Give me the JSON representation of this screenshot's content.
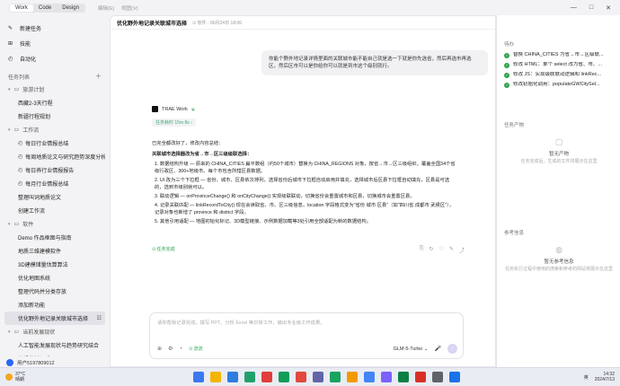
{
  "titlebar": {
    "modes": [
      "Work",
      "Code",
      "Design"
    ],
    "extras": [
      "编辑(E)",
      "视图(V)"
    ],
    "controls": [
      "—",
      "□",
      "✕"
    ]
  },
  "sidebar": {
    "top_items": [
      {
        "label": "新建任务",
        "icon": "edit-icon"
      },
      {
        "label": "技能",
        "icon": "grid-icon"
      },
      {
        "label": "自动化",
        "icon": "clock-icon"
      }
    ],
    "section_title": "任务列表",
    "groups": [
      {
        "name": "旅游计划",
        "items": [
          {
            "label": "西藏2-3天行程",
            "sched": false
          },
          {
            "label": "新疆行程规划",
            "sched": false
          }
        ]
      },
      {
        "name": "工作流",
        "items": [
          {
            "label": "每日行业情报总结",
            "sched": true
          },
          {
            "label": "每周地质论文与研究趋势深度分析",
            "sched": true
          },
          {
            "label": "每日养行业情报报告",
            "sched": true
          },
          {
            "label": "每月行业情报总结",
            "sched": true
          },
          {
            "label": "整理叫词地质论文",
            "sched": false
          },
          {
            "label": "创建工作流",
            "sched": false
          }
        ]
      },
      {
        "name": "软件",
        "items": [
          {
            "label": "Demo 作品框图与指南",
            "sched": false
          },
          {
            "label": "地质三维建模软件",
            "sched": false
          },
          {
            "label": "3D建模储量估算算法",
            "sched": false
          },
          {
            "label": "优化地图系统",
            "sched": false
          },
          {
            "label": "整理代码并分类存放",
            "sched": false
          },
          {
            "label": "添加新功能",
            "sched": false
          },
          {
            "label": "优化野外地记录关联城市选择",
            "sched": false,
            "active": true
          }
        ]
      },
      {
        "name": "当前发展现状",
        "items": [
          {
            "label": "人工智能发展现状与趋势研究结合",
            "sched": false
          },
          {
            "label": "地质学前沿成果",
            "sched": false
          }
        ]
      }
    ],
    "user": "用户5197809012"
  },
  "main": {
    "title": "优化野外地记录关联城市选择",
    "meta": "⊙ 软件 · 06月24日 18:06",
    "user_message": "你能个野外地记录详情里面的关联城市能不能自己就是选一下就是你先选省，然后再选市再选区，然后区市可以是你给你可以就是到市这个级别就行。",
    "bot_name": "TRAE Work",
    "bot_badge": "⬙",
    "task_time": "任务耗时 15m 8s ›",
    "answer_intro": "已完全都改好了，修改内容总结：",
    "answer_heading": "关联城市选择器改为省→市→区三级级联选择：",
    "answer_points": [
      "1. 数据结构升级 — 原来的 CHINA_CITIES 扁平数组（约50个城市）替换为 CHINA_REGIONS 对象，按省→市→区三级组织，覆盖全国34个省级行政区、300+地级市、每个市包含所辖区县数据。",
      "2. UI 改为三个下拉框 — 省份、城市、区县依次排列，选择省份后城市下拉框自动启用并填充，选择城市后区县下拉框自动填充，区县是可选的，选到市级别就可以。",
      "3. 联动逻辑 — onProvinceChange() 和 onCityChange() 实现级联联动，切换省份会重置城市和区县，切换城市会重置区县。",
      "4. 记录关联匹配 — linkRecordToCity() 现在会读取省、市、区三级信息，location 字段格式变为\"省份 城市 区县\"（如\"四川省 成都市 武侯区\"），记录对象也新增了 province 和 district 字段。",
      "5. 其他引用适配 — 地图初始化标记、3D模型链接、示例数据加载等3处引用全部适配为新的数据结构。"
    ],
    "done_tag": "⊙ 任务完成",
    "msg_tools": [
      "⎘",
      "↻",
      "♡",
      "✎",
      "⤴"
    ],
    "composer": {
      "placeholder": "请你帮我记录完成，撰写 PPT、分析 Excel 等日常工作，输出专业级工作成果。",
      "tools": [
        "⊕",
        "⚙",
        "◔"
      ],
      "flow": "⊙ 流流",
      "model": "GLM-5-Turbo ⌄",
      "mic": "🎤",
      "send": "↑"
    }
  },
  "right": {
    "todo_title": "待办",
    "todos": [
      "替换 CHINA_CITIES 为省→市→区级联...",
      "修改 HTML：单个 select 改为省、市、...",
      "修改 JS：实现级联联动逻辑和 linkRec...",
      "修改初始化调用：populateGWCitySel..."
    ],
    "artifacts_title": "任务产物",
    "artifacts_empty": "暂无产物",
    "artifacts_sub": "任务完成后，生成的文件将展示在这里",
    "refs_title": "参考信息",
    "refs_empty": "暂无参考信息",
    "refs_sub": "任务执行过程中使用的搜索和参考的网站将展示在这里"
  },
  "taskbar": {
    "temp": "37°C",
    "weather": "晴朗",
    "time": "14:32",
    "date": "2024/7/13",
    "lang": "英",
    "apps": [
      "#3a78f2",
      "#f4b400",
      "#2f7de1",
      "#22a06b",
      "#e23d3d",
      "#0f9d58",
      "#e2483d",
      "#6264a7",
      "#1aa260",
      "#f29900",
      "#4285f4",
      "#7b61ff",
      "#0b8043",
      "#d93025",
      "#5f6368",
      "#1a73e8"
    ]
  }
}
